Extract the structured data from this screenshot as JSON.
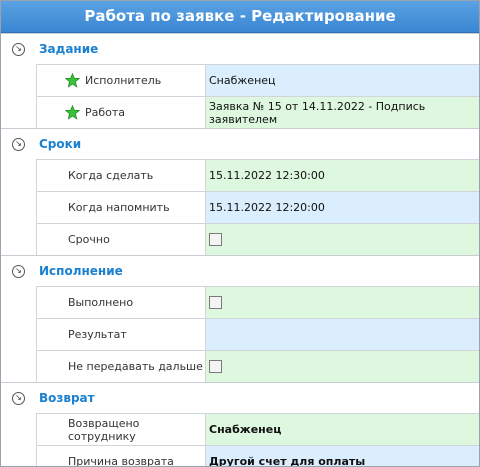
{
  "window": {
    "title": "Работа по заявке - Редактирование"
  },
  "sections": {
    "task": {
      "title": "Задание",
      "executor_label": "Исполнитель",
      "executor_value": "Снабженец",
      "work_label": "Работа",
      "work_value": "Заявка № 15 от 14.11.2022 - Подпись заявителем"
    },
    "deadlines": {
      "title": "Сроки",
      "when_do_label": "Когда сделать",
      "when_do_value": "15.11.2022 12:30:00",
      "when_remind_label": "Когда напомнить",
      "when_remind_value": "15.11.2022 12:20:00",
      "urgent_label": "Срочно"
    },
    "execution": {
      "title": "Исполнение",
      "done_label": "Выполнено",
      "result_label": "Результат",
      "result_value": "",
      "no_forward_label": "Не передавать дальше"
    },
    "return": {
      "title": "Возврат",
      "returned_to_label": "Возвращено сотруднику",
      "returned_to_value": "Снабженец",
      "reason_label": "Причина возврата",
      "reason_value": "Другой счет для оплаты"
    }
  },
  "icons": {
    "collapse": "collapse-circle-icon",
    "required": "green-star-icon"
  },
  "colors": {
    "title_bar": "#3b86d2",
    "section_title": "#1a80cf",
    "green_cell": "#ddf8de",
    "blue_cell": "#dbeefe"
  }
}
